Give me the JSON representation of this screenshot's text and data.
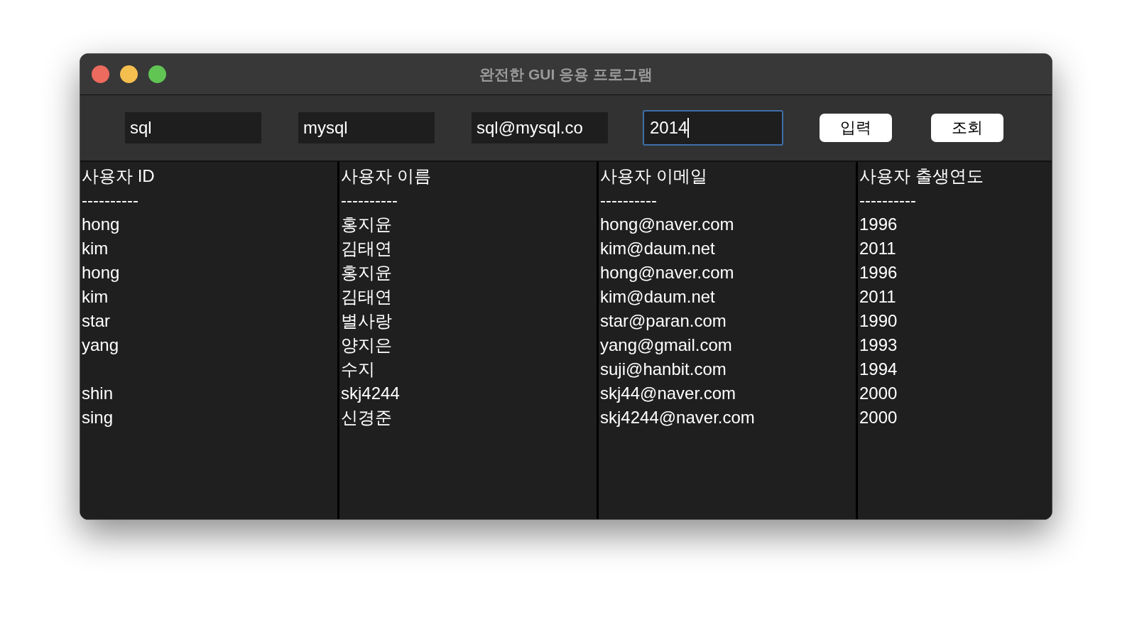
{
  "window": {
    "title": "완전한 GUI 응용 프로그램"
  },
  "fields": [
    {
      "value": "sql",
      "focused": false
    },
    {
      "value": "mysql",
      "focused": false
    },
    {
      "value": "sql@mysql.co",
      "focused": false
    },
    {
      "value": "2014",
      "focused": true
    }
  ],
  "buttons": [
    "입력",
    "조회"
  ],
  "columns": [
    {
      "header": "사용자 ID",
      "rule": "----------"
    },
    {
      "header": "사용자 이름",
      "rule": "----------"
    },
    {
      "header": "사용자 이메일",
      "rule": "----------"
    },
    {
      "header": "사용자 출생연도",
      "rule": "----------"
    }
  ],
  "rows": [
    {
      "id": "hong",
      "name": "홍지윤",
      "email": "hong@naver.com",
      "year": "1996"
    },
    {
      "id": "kim",
      "name": "김태연",
      "email": "kim@daum.net",
      "year": "2011"
    },
    {
      "id": "hong",
      "name": "홍지윤",
      "email": "hong@naver.com",
      "year": "1996"
    },
    {
      "id": "kim",
      "name": "김태연",
      "email": "kim@daum.net",
      "year": "2011"
    },
    {
      "id": "star",
      "name": "별사랑",
      "email": "star@paran.com",
      "year": "1990"
    },
    {
      "id": "yang",
      "name": "양지은",
      "email": "yang@gmail.com",
      "year": "1993"
    },
    {
      "name": "수지",
      "email": "suji@hanbit.com",
      "year": "1994"
    },
    {
      "id": "shin",
      "name": "skj4244",
      "email": "skj44@naver.com",
      "year": "2000"
    },
    {
      "id": "sing",
      "name": "신경준",
      "email": "skj4244@naver.com",
      "year": "2000"
    }
  ]
}
